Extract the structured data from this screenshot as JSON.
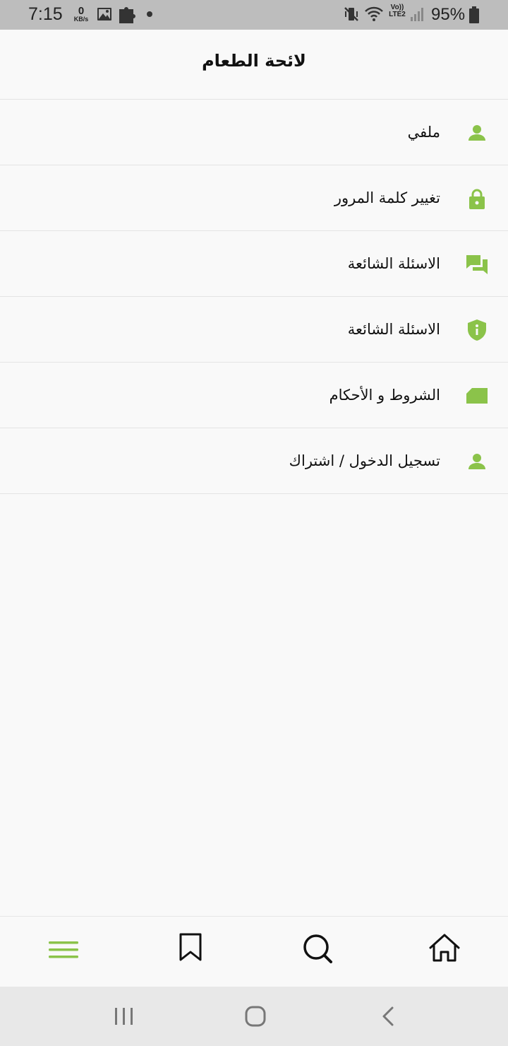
{
  "status_bar": {
    "time": "7:15",
    "data_speed_value": "0",
    "data_speed_unit": "KB/s",
    "network_label_top": "Vo))",
    "network_label_bottom": "LTE2",
    "battery_percent": "95%"
  },
  "header": {
    "title": "لائحة الطعام"
  },
  "menu": {
    "items": [
      {
        "label": "ملفي",
        "icon": "person-icon"
      },
      {
        "label": "تغيير كلمة المرور",
        "icon": "lock-icon"
      },
      {
        "label": "الاسئلة الشائعة",
        "icon": "chat-bubbles-icon"
      },
      {
        "label": "الاسئلة الشائعة",
        "icon": "shield-info-icon"
      },
      {
        "label": "الشروط و الأحكام",
        "icon": "ticket-icon"
      },
      {
        "label": "تسجيل الدخول / اشتراك",
        "icon": "person-icon"
      }
    ]
  },
  "bottom_nav": {
    "items": [
      {
        "name": "menu",
        "icon": "hamburger-menu-icon",
        "active": true
      },
      {
        "name": "bookmarks",
        "icon": "bookmark-icon",
        "active": false
      },
      {
        "name": "search",
        "icon": "search-icon",
        "active": false
      },
      {
        "name": "home",
        "icon": "home-icon",
        "active": false
      }
    ]
  },
  "system_nav": {
    "buttons": [
      "recent-apps-icon",
      "home-circle-icon",
      "back-chevron-icon"
    ]
  },
  "colors": {
    "accent": "#8bc34a",
    "status_bar_bg": "#bdbdbd",
    "background": "#f9f9f9",
    "divider": "#e4e4e4",
    "system_nav_bg": "#e8e8e8"
  }
}
